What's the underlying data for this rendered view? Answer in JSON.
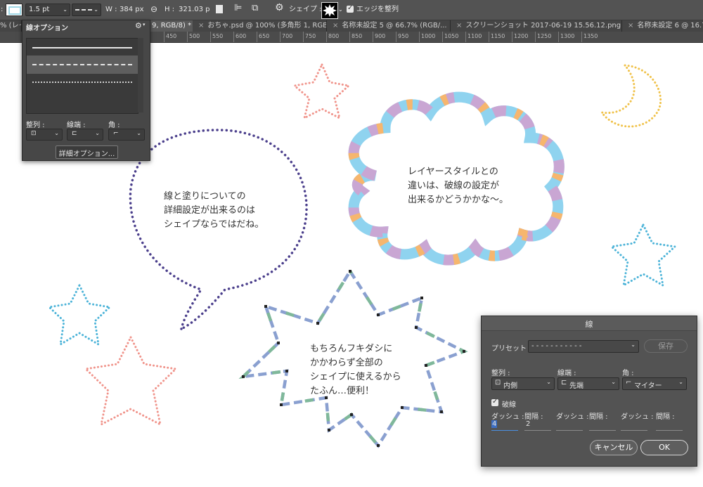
{
  "options_bar": {
    "stroke_prefix": ":",
    "stroke_width": "1.5 pt",
    "w_label": "W :",
    "w_value": "384 px",
    "link_icon": "link-icon",
    "h_label": "H :",
    "h_value": "321.03 p",
    "shape_label": "シェイプ :",
    "align_edges_label": "エッジを整列",
    "align_edges_checked": true
  },
  "tabs": [
    {
      "label": "% (レイ"
    },
    {
      "label": "9, RGB/8) *",
      "active": true
    },
    {
      "label": "おちゃ.psd @ 100% (多角形 1, RGB..."
    },
    {
      "label": "名称未設定 5 @ 66.7% (RGB/..."
    },
    {
      "label": "スクリーンショット 2017-06-19 15.56.12.png"
    },
    {
      "label": "名称未設定 6 @ 16.7"
    }
  ],
  "ruler": {
    "ticks": [
      "450",
      "500",
      "550",
      "600",
      "650",
      "700",
      "750",
      "800",
      "850",
      "900",
      "950",
      "1000",
      "1050",
      "1100",
      "1150",
      "1200",
      "1250",
      "1300",
      "1350"
    ]
  },
  "stroke_panel": {
    "title": "線オプション",
    "align_label": "整列 :",
    "cap_label": "線端 :",
    "corner_label": "角 :",
    "more_button": "詳細オプション..."
  },
  "canvas": {
    "left_bubble_lines": [
      "線と塗りについての",
      "詳細設定が出来るのは",
      "シェイプならではだね。"
    ],
    "cloud_lines": [
      "レイヤースタイルとの",
      "違いは、破線の設定が",
      "出来るかどうかかな〜。"
    ],
    "burst_lines": [
      "もちろんフキダシに",
      "かかわらず全部の",
      "シェイプに使えるから",
      "たふん…便利！"
    ]
  },
  "stroke_dialog": {
    "title": "線",
    "preset_label": "プリセット :",
    "preset_value": "- - - - - - - - - - -",
    "save_button": "保存",
    "align_label": "整列 :",
    "align_value": "内側",
    "cap_label": "線端 :",
    "cap_value": "先端",
    "corner_label": "角 :",
    "corner_value": "マイター",
    "dashed_label": "破線",
    "dashed_checked": true,
    "dash_label": "ダッシュ :",
    "gap_label": "間隔 :",
    "dash1": "4",
    "gap1": "2",
    "cancel_button": "キャンセル",
    "ok_button": "OK"
  },
  "colors": {
    "bubble_stroke": "#4b3f8c",
    "star_pink": "#f0938a",
    "star_blue": "#4bb3d8",
    "moon": "#f0c24a",
    "cloud_a": "#8fd3ef",
    "cloud_b": "#c9a6d3",
    "burst_blue": "#8aa0d0",
    "burst_green": "#7fb89a"
  }
}
